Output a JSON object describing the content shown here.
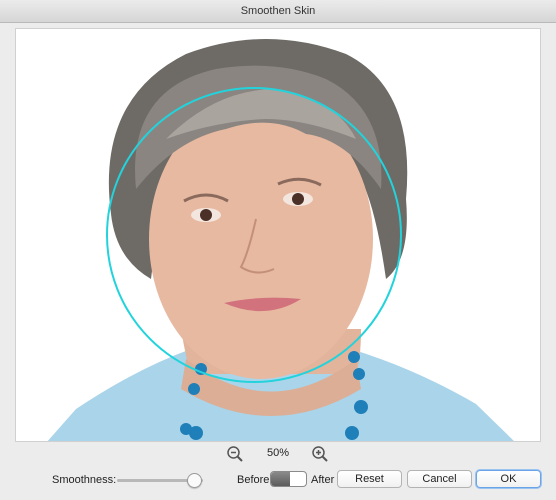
{
  "window": {
    "title": "Smoothen Skin"
  },
  "zoom": {
    "level": "50%",
    "zoom_out_icon": "zoom-out-magnifier-icon",
    "zoom_in_icon": "zoom-in-magnifier-icon"
  },
  "controls": {
    "smoothness_label": "Smoothness:",
    "smoothness_value_fraction": 0.9,
    "before_label": "Before",
    "after_label": "After",
    "toggle_state": "before"
  },
  "buttons": {
    "reset": "Reset",
    "cancel": "Cancel",
    "ok": "OK"
  },
  "colors": {
    "face_circle": "#22d3dc",
    "accent": "#6aa3e6"
  }
}
